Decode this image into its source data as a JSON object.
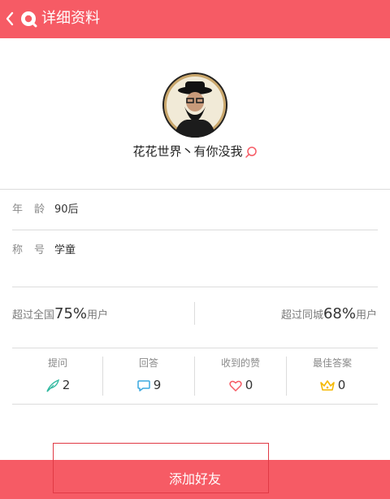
{
  "header": {
    "title": "详细资料",
    "back_icon": "back-chevron-icon",
    "logo_icon": "qzone-logo-icon"
  },
  "profile": {
    "nickname": "花花世界丶有你没我",
    "nickname_icon": "search-icon",
    "avatar": "avatar-bearded-man-hat"
  },
  "info": [
    {
      "label": "年龄",
      "value": "90后"
    },
    {
      "label": "称号",
      "value": "学童"
    }
  ],
  "compare": {
    "national": {
      "prefix": "超过全国",
      "percent": "75%",
      "suffix": "用户"
    },
    "city": {
      "prefix": "超过同城",
      "percent": "68%",
      "suffix": "用户"
    }
  },
  "stats": [
    {
      "label": "提问",
      "value": "2",
      "icon": "feather-icon",
      "color": "#2fb9a0"
    },
    {
      "label": "回答",
      "value": "9",
      "icon": "speech-bubble-icon",
      "color": "#3aa8df"
    },
    {
      "label": "收到的赞",
      "value": "0",
      "icon": "heart-icon",
      "color": "#f65b65"
    },
    {
      "label": "最佳答案",
      "value": "0",
      "icon": "crown-icon",
      "color": "#f5b800"
    }
  ],
  "actions": {
    "add_friend": "添加好友"
  },
  "colors": {
    "brand": "#f65b65",
    "divider": "#dcdcdc"
  }
}
